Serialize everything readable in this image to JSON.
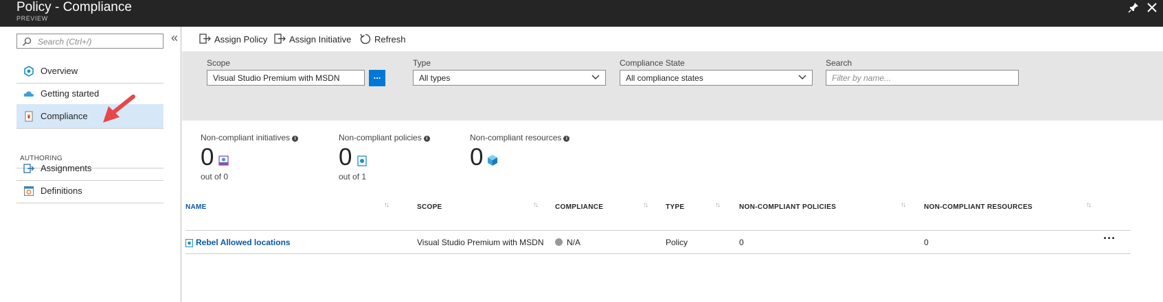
{
  "window": {
    "title": "Policy - Compliance",
    "subtitle": "PREVIEW"
  },
  "sidebar": {
    "search_placeholder": "Search (Ctrl+/)",
    "collapse_glyph": "«",
    "items": [
      {
        "label": "Overview",
        "icon": "overview-icon"
      },
      {
        "label": "Getting started",
        "icon": "cloud-icon"
      },
      {
        "label": "Compliance",
        "icon": "compliance-icon",
        "active": true
      }
    ],
    "section_label": "AUTHORING",
    "authoring_items": [
      {
        "label": "Assignments",
        "icon": "assignments-icon"
      },
      {
        "label": "Definitions",
        "icon": "definitions-icon"
      }
    ]
  },
  "toolbar": {
    "assign_policy": "Assign Policy",
    "assign_initiative": "Assign Initiative",
    "refresh": "Refresh"
  },
  "filters": {
    "scope_label": "Scope",
    "scope_value": "Visual Studio Premium with MSDN",
    "scope_button": "...",
    "type_label": "Type",
    "type_value": "All types",
    "compliance_label": "Compliance State",
    "compliance_value": "All compliance states",
    "search_label": "Search",
    "search_placeholder": "Filter by name..."
  },
  "stats": {
    "initiatives": {
      "label": "Non-compliant initiatives",
      "value": "0",
      "sub": "out of 0"
    },
    "policies": {
      "label": "Non-compliant policies",
      "value": "0",
      "sub": "out of 1"
    },
    "resources": {
      "label": "Non-compliant resources",
      "value": "0"
    }
  },
  "table": {
    "headers": {
      "name": "NAME",
      "scope": "SCOPE",
      "compliance": "COMPLIANCE",
      "type": "TYPE",
      "noncompliant_policies": "NON-COMPLIANT POLICIES",
      "noncompliant_resources": "NON-COMPLIANT RESOURCES"
    },
    "rows": [
      {
        "name": "Rebel Allowed locations",
        "scope": "Visual Studio Premium with MSDN",
        "compliance": "N/A",
        "type": "Policy",
        "noncompliant_policies": "0",
        "noncompliant_resources": "0"
      }
    ]
  },
  "colors": {
    "accent": "#0078d7",
    "titlebar": "#252525",
    "active_nav": "#d6e8f8",
    "filter_bar": "#e5e5e5",
    "arrow": "#e8484b"
  }
}
